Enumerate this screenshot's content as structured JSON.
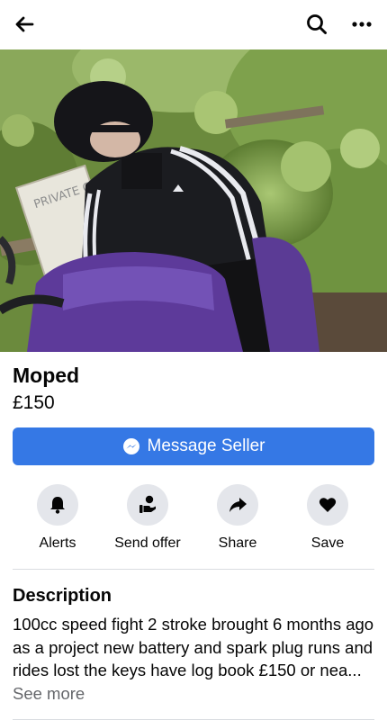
{
  "header": {
    "back_icon": "arrow-left-icon",
    "search_icon": "search-icon",
    "more_icon": "more-horizontal-icon"
  },
  "listing": {
    "photo_sign_text": "PRIVATE CAR PARK",
    "title": "Moped",
    "price": "£150"
  },
  "message_button": {
    "icon": "messenger-icon",
    "label": "Message Seller",
    "color": "#3578e5"
  },
  "actions": [
    {
      "label": "Alerts",
      "icon": "bell-icon"
    },
    {
      "label": "Send offer",
      "icon": "send-offer-icon"
    },
    {
      "label": "Share",
      "icon": "share-arrow-icon"
    },
    {
      "label": "Save",
      "icon": "heart-icon"
    }
  ],
  "description": {
    "heading": "Description",
    "text": "100cc speed fight 2 stroke brought 6 months ago as a project new battery and spark plug runs and rides lost the keys have log book £150 or nea...",
    "see_more": "See more"
  }
}
